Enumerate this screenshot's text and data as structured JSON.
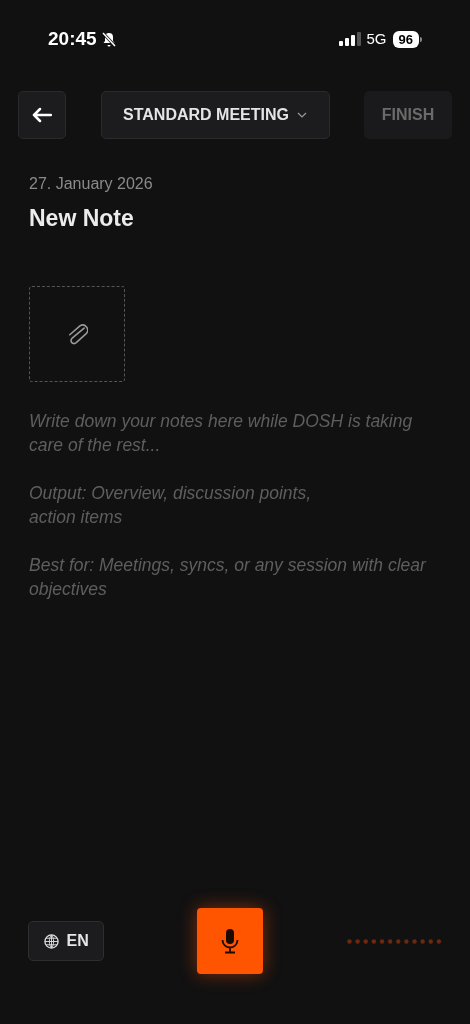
{
  "status_bar": {
    "time": "20:45",
    "network": "5G",
    "battery": "96"
  },
  "toolbar": {
    "template": "STANDARD MEETING",
    "finish": {
      "label": "FINISH",
      "disabled": true
    }
  },
  "note": {
    "date": "27. January 2026",
    "title": "New Note",
    "placeholder": "Write down your notes here while DOSH is taking care of the rest...\n\nOutput: Overview, discussion points,\naction items\n\nBest for: Meetings, syncs, or any session with clear objectives"
  },
  "bottom_bar": {
    "language": "EN",
    "recording": false
  }
}
